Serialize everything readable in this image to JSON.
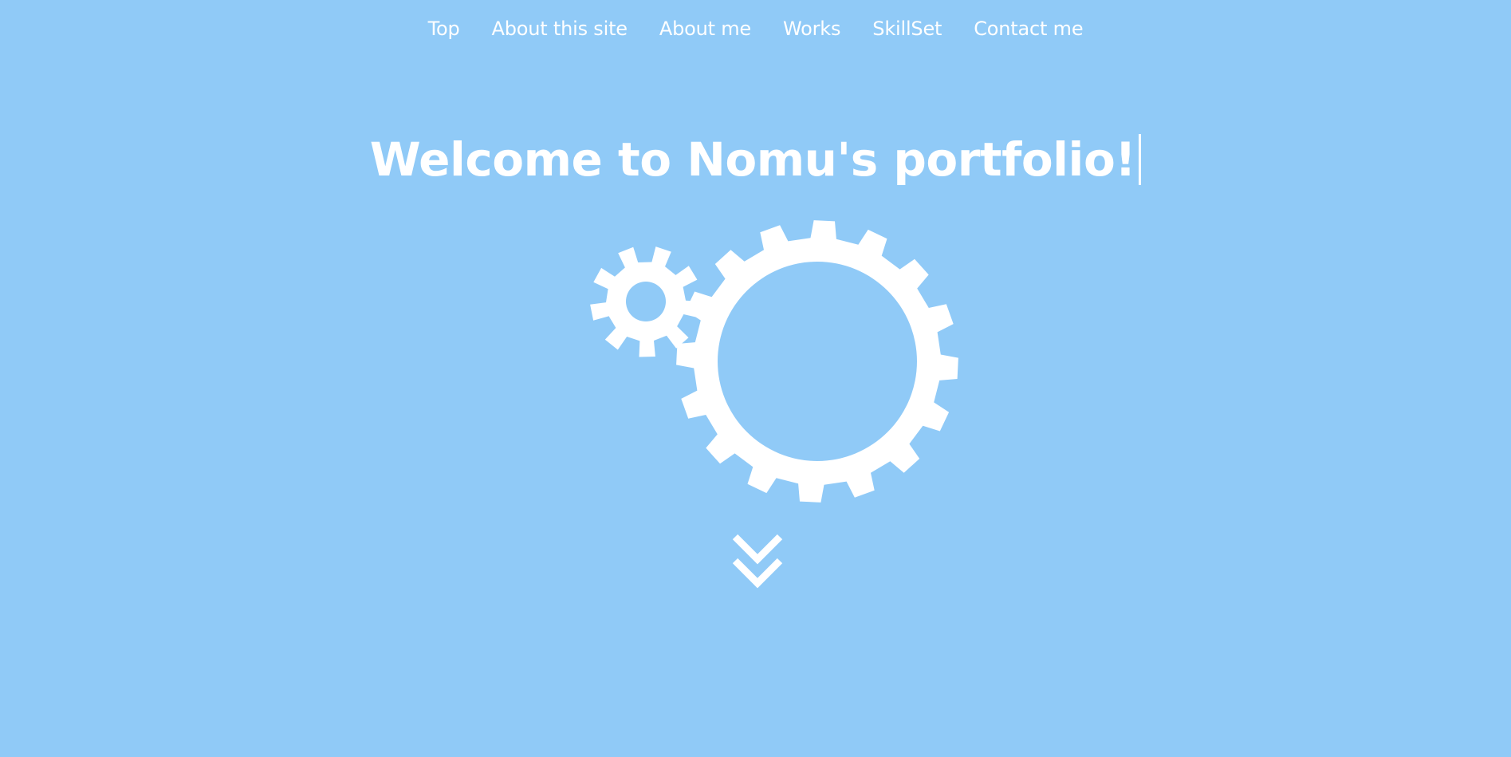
{
  "nav": {
    "items": [
      {
        "label": "Top"
      },
      {
        "label": "About this site"
      },
      {
        "label": "About me"
      },
      {
        "label": "Works"
      },
      {
        "label": "SkillSet"
      },
      {
        "label": "Contact me"
      }
    ]
  },
  "hero": {
    "title": "Welcome to Nomu's portfolio!"
  },
  "icons": {
    "small_gear": "gear-icon",
    "large_gear": "gear-icon",
    "scroll": "double-chevron-down-icon"
  },
  "colors": {
    "background": "#90caf7",
    "foreground": "#ffffff"
  }
}
